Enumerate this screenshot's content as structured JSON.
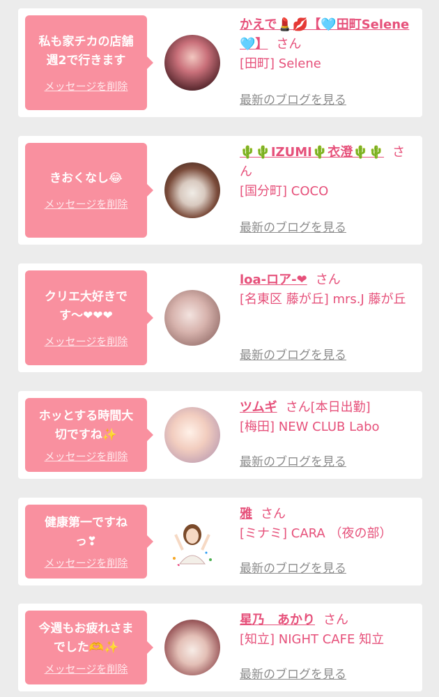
{
  "colors": {
    "bubble": "#f9909f",
    "accent": "#e6507a",
    "link_gray": "#8c8c8c",
    "background": "#ececec"
  },
  "delete_label": "メッセージを削除",
  "blog_label": "最新のブログを見る",
  "san_label": "さん",
  "cards": [
    {
      "message": "私も家チカの店舗\n週2で行きます",
      "name": "かえで💄💋【🩵田町Selene🩵】",
      "status": "",
      "shop": "[田町] Selene"
    },
    {
      "message": "きおくなし😂",
      "name": "🌵🌵IZUMI🌵衣澄🌵🌵",
      "status": "",
      "shop": "[国分町] COCO"
    },
    {
      "message": "クリエ大好きで\nす〜❤❤❤",
      "name": "loa-ロア-❤",
      "status": "",
      "shop": "[名東区 藤が丘] mrs.J 藤が丘"
    },
    {
      "message": "ホッとする時間大\n切ですね✨",
      "name": "ツムギ",
      "status": "[本日出勤]",
      "shop": "[梅田] NEW CLUB Labo"
    },
    {
      "message": "健康第一ですね\nっ❣",
      "name": "雅",
      "status": "",
      "shop": "[ミナミ] CARA （夜の部）"
    },
    {
      "message": "今週もお疲れさま\nでした🫶✨",
      "name": "星乃　あかり",
      "status": "",
      "shop": "[知立] NIGHT CAFE 知立"
    }
  ]
}
